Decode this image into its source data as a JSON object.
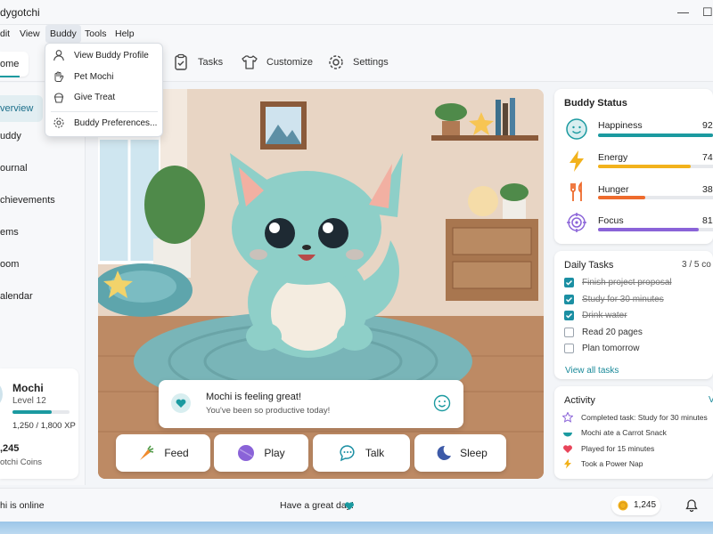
{
  "window": {
    "title": "dygotchi",
    "minimize": "—",
    "maximize": "☐"
  },
  "menu": {
    "items": [
      "dit",
      "View",
      "Buddy",
      "Tools",
      "Help"
    ]
  },
  "dropdown": {
    "items": [
      "View Buddy Profile",
      "Pet Mochi",
      "Give Treat",
      "Buddy Preferences..."
    ]
  },
  "toolbar": {
    "home": "ome",
    "tabs": [
      "Tasks",
      "Customize",
      "Settings"
    ]
  },
  "sidebar": {
    "items": [
      "verview",
      "uddy",
      "ournal",
      "chievements",
      "ems",
      "oom",
      "alendar"
    ]
  },
  "profile": {
    "name": "Mochi",
    "level": "Level 12",
    "xp": "1,250 / 1,800 XP",
    "xp_fraction": 0.694,
    "coins": ",245",
    "coins_label": "otchi Coins"
  },
  "speech": {
    "title": "Mochi is feeling great!",
    "subtitle": "You've been so productive today!"
  },
  "actions": [
    "Feed",
    "Play",
    "Talk",
    "Sleep"
  ],
  "status": {
    "title": "Buddy Status",
    "stats": [
      {
        "label": "Happiness",
        "value": "92",
        "percent": 92,
        "color": "#1b9aa0"
      },
      {
        "label": "Energy",
        "value": "74",
        "percent": 74,
        "color": "#f2b21c"
      },
      {
        "label": "Hunger",
        "value": "38",
        "percent": 38,
        "color": "#ee6b2d"
      },
      {
        "label": "Focus",
        "value": "81",
        "percent": 81,
        "color": "#8a63d8"
      }
    ]
  },
  "tasks": {
    "title": "Daily Tasks",
    "count": "3 / 5 co",
    "items": [
      {
        "label": "Finish project proposal",
        "done": true
      },
      {
        "label": "Study for 30 minutes",
        "done": true
      },
      {
        "label": "Drink water",
        "done": true
      },
      {
        "label": "Read 20 pages",
        "done": false
      },
      {
        "label": "Plan tomorrow",
        "done": false
      }
    ],
    "link": "View all tasks"
  },
  "activity": {
    "title": "Activity",
    "more": "V",
    "items": [
      {
        "text": "Completed task: Study for 30 minutes",
        "icon": "star-icon"
      },
      {
        "text": "Mochi ate a Carrot Snack",
        "icon": "bowl-icon"
      },
      {
        "text": "Played for 15 minutes",
        "icon": "heart-icon"
      },
      {
        "text": "Took a Power Nap",
        "icon": "bolt-icon"
      }
    ]
  },
  "statusbar": {
    "online": "hi is online",
    "message": "Have a great day!",
    "coins": "1,245"
  },
  "colors": {
    "accent": "#1b9aa0",
    "check": "#1b8fa3",
    "link": "#1b8a9a"
  }
}
